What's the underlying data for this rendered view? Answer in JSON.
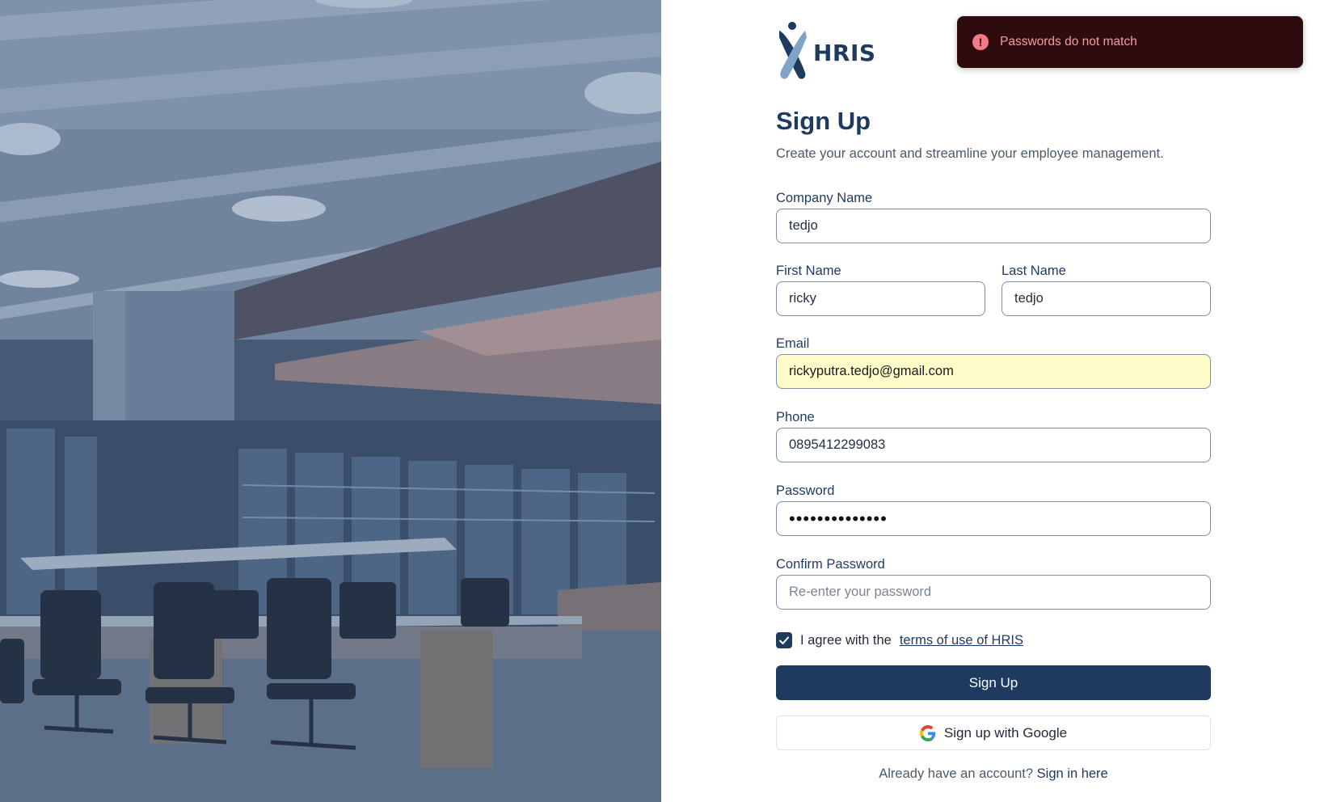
{
  "brand": {
    "name": "HRIS"
  },
  "header": {
    "title": "Sign Up",
    "subtitle": "Create your account and streamline your employee management."
  },
  "form": {
    "company_name": {
      "label": "Company Name",
      "value": "tedjo"
    },
    "first_name": {
      "label": "First Name",
      "value": "ricky"
    },
    "last_name": {
      "label": "Last Name",
      "value": "tedjo"
    },
    "email": {
      "label": "Email",
      "value": "rickyputra.tedjo@gmail.com"
    },
    "phone": {
      "label": "Phone",
      "value": "0895412299083"
    },
    "password": {
      "label": "Password",
      "value": "••••••••••••••"
    },
    "confirm_password": {
      "label": "Confirm Password",
      "value": "",
      "placeholder": "Re-enter your password"
    },
    "terms": {
      "prefix": "I agree with the",
      "link": "terms of use of HRIS",
      "checked": true
    },
    "submit_label": "Sign Up",
    "google_label": "Sign up with Google"
  },
  "footer": {
    "prompt": "Already have an account?",
    "link": "Sign in here"
  },
  "toast": {
    "message": "Passwords do not match",
    "type": "error",
    "icon": "alert-icon"
  },
  "colors": {
    "primary": "#1e3a5f",
    "toast_bg": "#2e0c0e",
    "toast_text": "#f49ba4",
    "autofill": "#fefcc9"
  }
}
